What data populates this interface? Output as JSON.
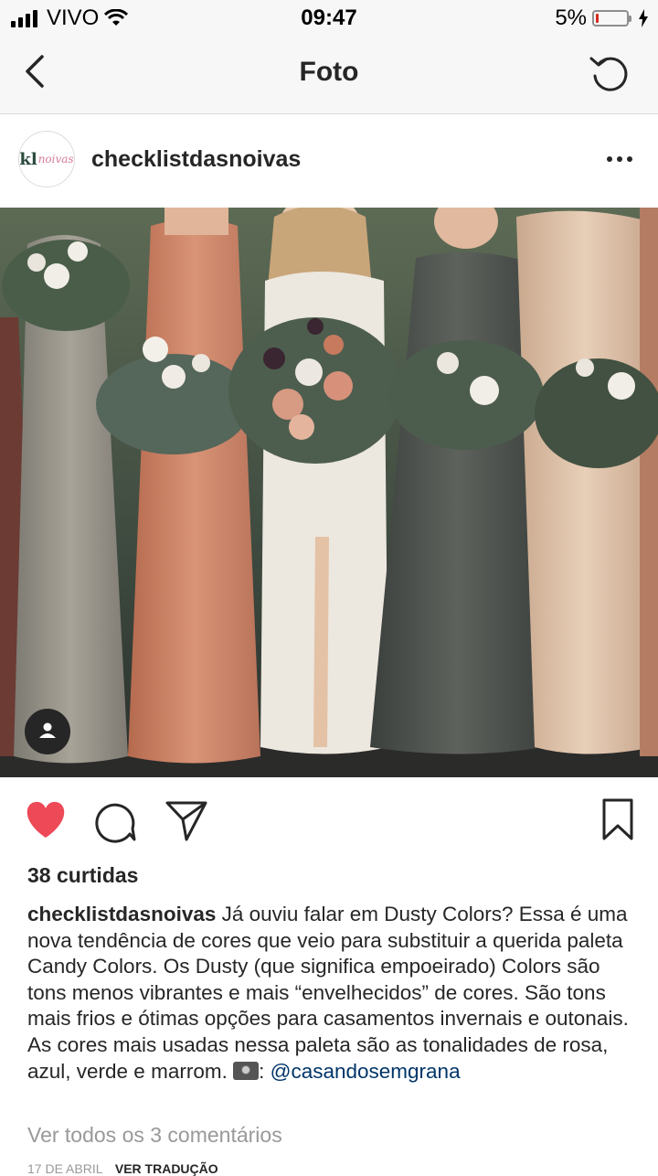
{
  "status_bar": {
    "carrier": "VIVO",
    "time": "09:47",
    "battery": "5%",
    "battery_level": 0.05
  },
  "nav": {
    "title": "Foto",
    "back_icon": "chevron-left-icon",
    "refresh_icon": "refresh-icon"
  },
  "post": {
    "username": "checklistdasnoivas",
    "avatar_logo_main": "kl",
    "avatar_logo_script": "noivas",
    "likes": "38 curtidas",
    "caption_user": "checklistdasnoivas",
    "caption_text": "Já ouviu falar em Dusty Colors? Essa é uma nova tendência de cores que veio para substituir a querida paleta Candy Colors. Os Dusty (que significa empoeirado) Colors são tons menos vibrantes e mais “envelhecidos” de cores. São tons mais frios e ótimas opções para casamentos invernais e outonais. As cores mais usadas nessa paleta são as tonalidades de rosa, azul, verde e marrom.",
    "caption_suffix": ":",
    "mention": "@casandosemgrana",
    "view_comments": "Ver todos os 3 comentários",
    "date": "17 DE ABRIL",
    "translate": "VER TRADUÇÃO"
  },
  "colors": {
    "heart": "#ed4956",
    "mention": "#003569",
    "muted": "#999999"
  }
}
